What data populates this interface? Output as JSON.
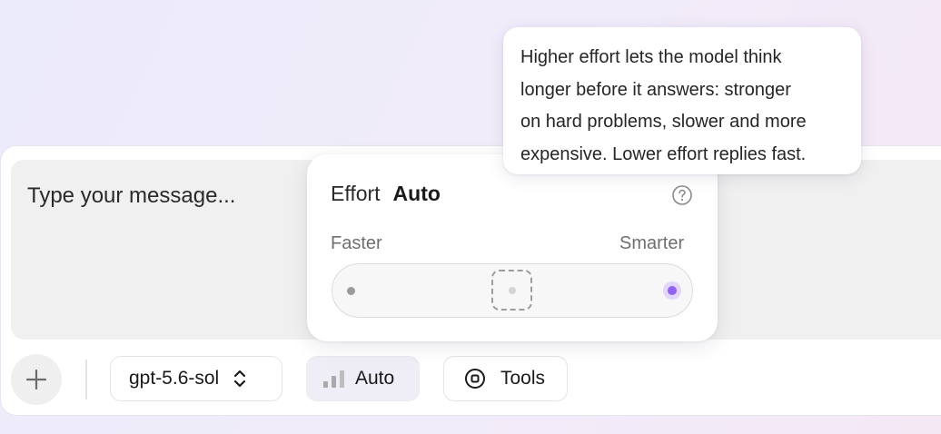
{
  "composer": {
    "placeholder": "Type your message..."
  },
  "toolbar": {
    "add_icon": "plus-icon",
    "model_label": "gpt-5.6-sol",
    "model_icon": "chevron-up-down-icon",
    "effort_label": "Auto",
    "effort_icon": "signal-bars-icon",
    "tools_label": "Tools",
    "tools_icon": "tools-icon"
  },
  "effort_popup": {
    "title": "Effort",
    "value": "Auto",
    "help_icon": "help-icon",
    "min_label": "Faster",
    "max_label": "Smarter",
    "slider_level": 0.5,
    "accent_color": "#8f63ee"
  },
  "tooltip": {
    "lines": [
      "Higher effort lets the model think",
      "longer before it answers: stronger",
      "on hard problems, slower and more",
      "expensive. Lower effort replies fast."
    ]
  }
}
